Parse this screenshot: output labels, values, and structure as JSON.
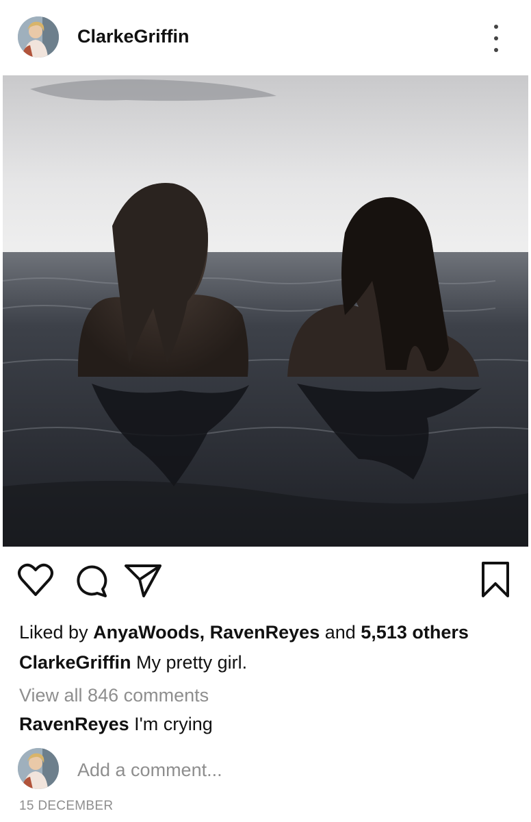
{
  "post": {
    "username": "ClarkeGriffin",
    "more_icon": "more-vertical-icon",
    "image_icon": "photo",
    "likes": {
      "prefix": "Liked by ",
      "user1": "AnyaWoods",
      "separator": ", ",
      "user2": "RavenReyes",
      "and": " and ",
      "others": "5,513 others"
    },
    "caption": {
      "author": "ClarkeGriffin",
      "text": " My pretty girl."
    },
    "view_all_comments": "View all 846 comments",
    "top_comment": {
      "author": "RavenReyes",
      "text": " I'm crying"
    },
    "add_comment_placeholder": "Add a comment...",
    "date": "15 DECEMBER"
  },
  "actions": {
    "like": "heart-icon",
    "comment": "comment-icon",
    "share": "send-icon",
    "save": "bookmark-icon"
  }
}
